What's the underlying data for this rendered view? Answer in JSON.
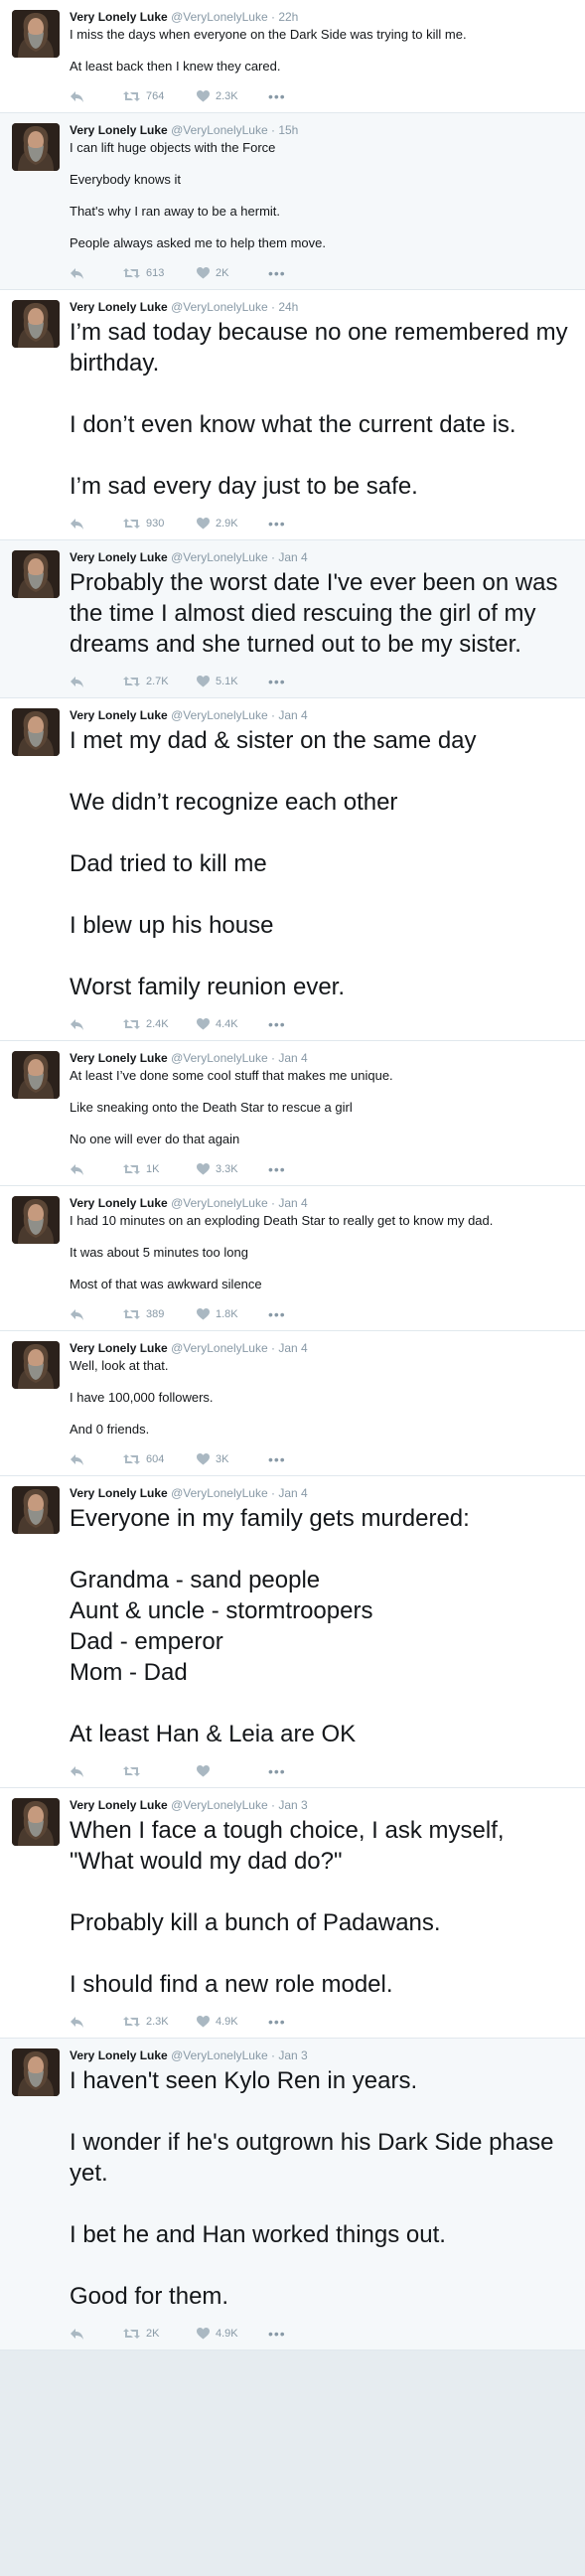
{
  "account": {
    "name": "Very Lonely Luke",
    "handle": "@VeryLonelyLuke",
    "separator": "·"
  },
  "icons": {
    "reply": "reply-icon",
    "retweet": "retweet-icon",
    "like": "heart-icon",
    "more": "more-icon"
  },
  "colors": {
    "meta_gray": "#8899a6",
    "background": "#e6ecf0",
    "divider": "#e1e8ed"
  },
  "tweets": [
    {
      "time": "22h",
      "size": "small",
      "bg": "white",
      "paragraphs": [
        "I miss the days when everyone on the Dark Side was trying to kill me.",
        "At least back then I knew they cared."
      ],
      "retweets": "764",
      "likes": "2.3K"
    },
    {
      "time": "15h",
      "size": "small",
      "bg": "tinted",
      "paragraphs": [
        "I can lift huge objects with the Force",
        "Everybody knows it",
        "That's why I ran away to be a hermit.",
        "People always asked me to help them move."
      ],
      "retweets": "613",
      "likes": "2K"
    },
    {
      "time": "24h",
      "size": "large",
      "bg": "white",
      "paragraphs": [
        "I’m sad today because no one remembered my birthday.",
        "I don’t even know what the current date is.",
        "I’m sad every day just to be safe."
      ],
      "retweets": "930",
      "likes": "2.9K"
    },
    {
      "time": "Jan 4",
      "size": "large",
      "bg": "tinted",
      "paragraphs": [
        "Probably the worst date I've ever been on was the time I almost died rescuing the girl of my dreams and she turned out to be my sister."
      ],
      "retweets": "2.7K",
      "likes": "5.1K"
    },
    {
      "time": "Jan 4",
      "size": "large",
      "bg": "white",
      "paragraphs": [
        "I met my dad & sister on the same day",
        "We didn’t recognize each other",
        "Dad tried to kill me",
        "I blew up his house",
        "Worst family reunion ever."
      ],
      "retweets": "2.4K",
      "likes": "4.4K"
    },
    {
      "time": "Jan 4",
      "size": "small",
      "bg": "white",
      "paragraphs": [
        "At least I’ve done some cool stuff that makes me unique.",
        "Like sneaking onto the Death Star to rescue a girl",
        "No one will ever do that again"
      ],
      "retweets": "1K",
      "likes": "3.3K"
    },
    {
      "time": "Jan 4",
      "size": "small",
      "bg": "white",
      "paragraphs": [
        "I had 10 minutes on an exploding Death Star to really get to know my dad.",
        "It was about 5 minutes too long",
        "Most of that was awkward silence"
      ],
      "retweets": "389",
      "likes": "1.8K"
    },
    {
      "time": "Jan 4",
      "size": "small",
      "bg": "white",
      "paragraphs": [
        "Well, look at that.",
        "I have 100,000 followers.",
        "And 0 friends."
      ],
      "retweets": "604",
      "likes": "3K"
    },
    {
      "time": "Jan 4",
      "size": "large",
      "bg": "white",
      "paragraphs": [
        "Everyone in my family gets murdered:",
        "Grandma - sand people",
        "Aunt & uncle - stormtroopers",
        "Dad - emperor",
        "Mom - Dad",
        "At least Han & Leia are OK"
      ],
      "tight": [
        2,
        3,
        4
      ],
      "retweets": null,
      "likes": null
    },
    {
      "time": "Jan 3",
      "size": "large",
      "bg": "white",
      "paragraphs": [
        "When I face a tough choice, I ask myself, \"What would my dad do?\"",
        "Probably kill a bunch of Padawans.",
        "I should find a new role model."
      ],
      "retweets": "2.3K",
      "likes": "4.9K"
    },
    {
      "time": "Jan 3",
      "size": "large",
      "bg": "tinted",
      "paragraphs": [
        "I haven't seen Kylo Ren in years.",
        "I wonder if he's outgrown his Dark Side phase yet.",
        "I bet he and Han worked things out.",
        "Good for them."
      ],
      "retweets": "2K",
      "likes": "4.9K"
    }
  ]
}
